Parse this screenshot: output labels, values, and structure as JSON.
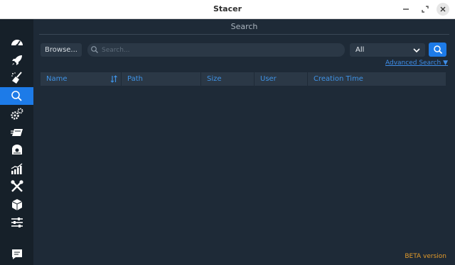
{
  "window": {
    "title": "Stacer",
    "controls": [
      "minimize",
      "maximize",
      "close"
    ]
  },
  "sidebar": {
    "items": [
      {
        "icon": "dashboard-gauge-icon",
        "active": false
      },
      {
        "icon": "rocket-icon",
        "active": false
      },
      {
        "icon": "broom-cleaner-icon",
        "active": false
      },
      {
        "icon": "search-icon",
        "active": true
      },
      {
        "icon": "gears-icon",
        "active": false
      },
      {
        "icon": "uninstaller-icon",
        "active": false
      },
      {
        "icon": "resources-disk-icon",
        "active": false
      },
      {
        "icon": "stats-chart-icon",
        "active": false
      },
      {
        "icon": "tools-icon",
        "active": false
      },
      {
        "icon": "package-box-icon",
        "active": false
      },
      {
        "icon": "settings-sliders-icon",
        "active": false
      },
      {
        "icon": "feedback-chat-icon",
        "active": false
      }
    ]
  },
  "main": {
    "page_title": "Search",
    "browse_label": "Browse...",
    "search": {
      "placeholder": "Search...",
      "value": ""
    },
    "type_select": {
      "value": "All"
    },
    "advanced_search_label": "Advanced Search ▼",
    "table": {
      "columns": [
        "Name",
        "Path",
        "Size",
        "User",
        "Creation Time"
      ],
      "rows": []
    },
    "beta_label": "BETA version"
  },
  "colors": {
    "accent": "#1d7be8",
    "background": "#1e2a37",
    "sidebar": "#162029",
    "header_text": "#3f93e6",
    "beta": "#e29a2a"
  }
}
